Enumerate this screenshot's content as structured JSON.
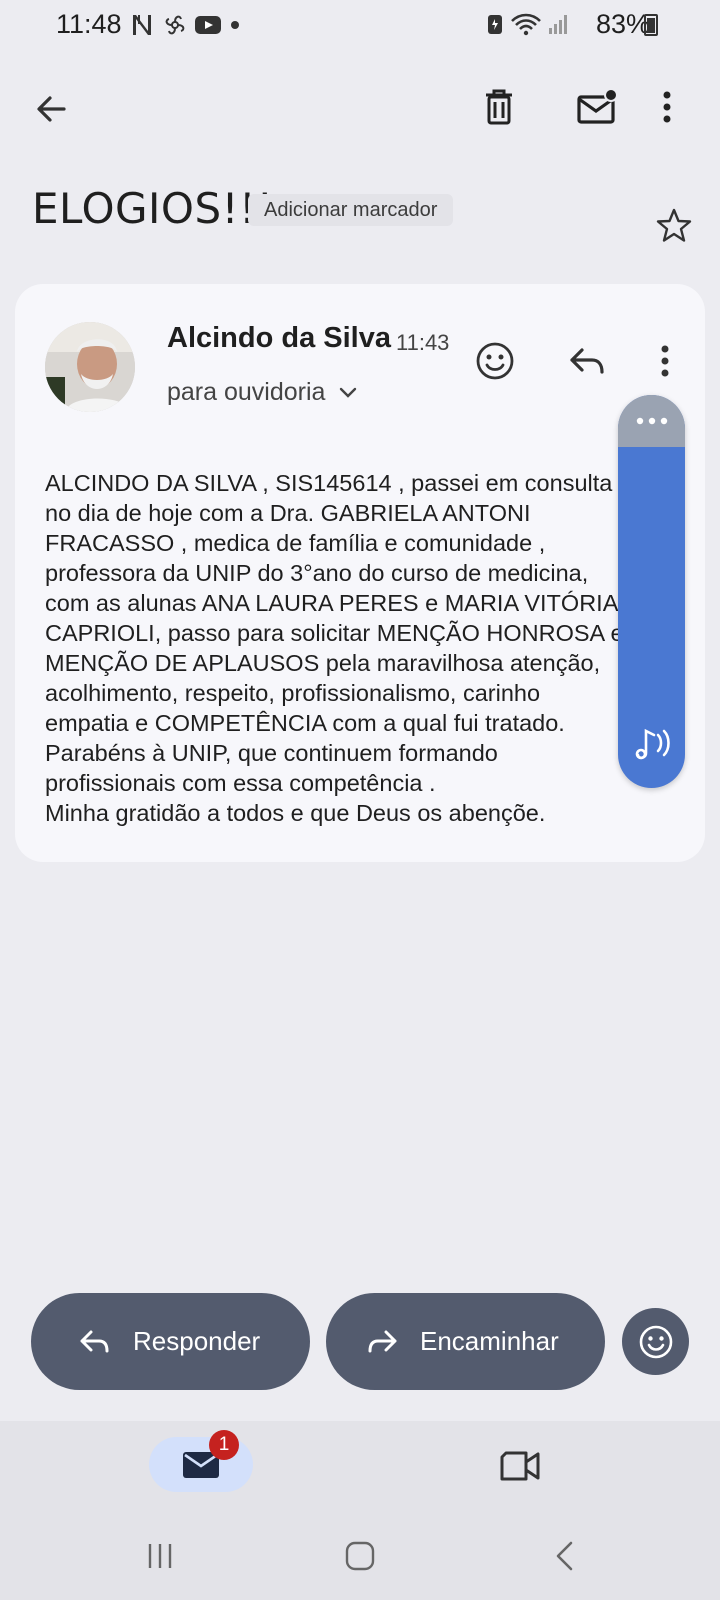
{
  "status_bar": {
    "time": "11:48",
    "battery": "83%"
  },
  "top_bar": {
    "back_icon": "arrow-left-icon",
    "delete_icon": "trash-icon",
    "mark_unread_icon": "mail-unread-icon",
    "more_icon": "more-vert-icon"
  },
  "subject": {
    "title": "ELOGIOS!!!",
    "label_chip": "Adicionar marcador",
    "star_icon": "star-outline-icon"
  },
  "message": {
    "sender": "Alcindo da Silva",
    "time": "11:43",
    "recipient": "para ouvidoria",
    "body": "ALCINDO DA SILVA , SIS145614 , passei em consulta\nno dia de hoje com a Dra. GABRIELA ANTONI\nFRACASSO , medica de família e comunidade ,\nprofessora da UNIP do 3°ano do curso de medicina,\ncom as alunas ANA LAURA PERES e MARIA VITÓRIA\nCAPRIOLI, passo para solicitar MENÇÃO HONROSA e\nMENÇÃO DE APLAUSOS pela maravilhosa atenção,\nacolhimento, respeito, profissionalismo, carinho\nempatia e COMPETÊNCIA com a qual fui tratado.\nParabéns à UNIP, que continuem formando\nprofissionais com essa competência .\nMinha gratidão a todos e que Deus os abençõe."
  },
  "actions": {
    "reply_label": "Responder",
    "forward_label": "Encaminhar"
  },
  "bottom_nav": {
    "mail_badge": "1"
  },
  "colors": {
    "background": "#ececf1",
    "card": "#f7f7fb",
    "action_button": "#535b6e",
    "voice_panel": "#4a78d2",
    "badge": "#c5221f",
    "active_tab": "#d3e0fb"
  }
}
